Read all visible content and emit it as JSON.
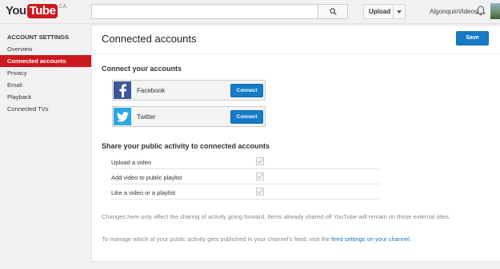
{
  "header": {
    "logo_you": "You",
    "logo_tube": "Tube",
    "region": "CA",
    "search_placeholder": "",
    "upload_label": "Upload",
    "username": "AlgonquinVideos"
  },
  "sidebar": {
    "heading": "ACCOUNT SETTINGS",
    "items": [
      {
        "label": "Overview"
      },
      {
        "label": "Connected accounts",
        "active": true
      },
      {
        "label": "Privacy"
      },
      {
        "label": "Email"
      },
      {
        "label": "Playback"
      },
      {
        "label": "Connected TVs"
      }
    ]
  },
  "main": {
    "title": "Connected accounts",
    "save_label": "Save",
    "connect_heading": "Connect your accounts",
    "accounts": [
      {
        "name": "Facebook",
        "button": "Connect",
        "icon": "facebook-icon",
        "color": "#3b5998"
      },
      {
        "name": "Twitter",
        "button": "Connect",
        "icon": "twitter-icon",
        "color": "#2ca8e0"
      }
    ],
    "share_heading": "Share your public activity to connected accounts",
    "activities": [
      {
        "label": "Upload a video",
        "checked": true
      },
      {
        "label": "Add video to public playlist",
        "checked": true
      },
      {
        "label": "Like a video or a playlist",
        "checked": true
      }
    ],
    "note1": "Changes here only affect the sharing of activity going forward. Items already shared off YouTube will remain on those external sites.",
    "note2_prefix": "To manage which of your public activity gets published in your channel's feed, visit the ",
    "note2_link": "feed settings on your channel",
    "note2_suffix": "."
  },
  "colors": {
    "brand_red": "#cc181e",
    "accent_blue": "#167ac6"
  }
}
